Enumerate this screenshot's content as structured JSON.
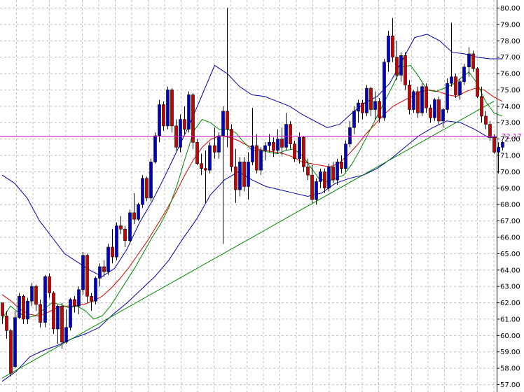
{
  "chart_data": {
    "type": "candlestick",
    "title": "",
    "xlabel": "",
    "ylabel": "",
    "ylim": [
      56.5,
      80.4
    ],
    "y_ticks": [
      "57.00",
      "58.00",
      "59.00",
      "60.00",
      "61.00",
      "62.00",
      "63.00",
      "64.00",
      "65.00",
      "66.00",
      "67.00",
      "68.00",
      "69.00",
      "70.00",
      "71.00",
      "72.00",
      "73.00",
      "74.00",
      "75.00",
      "76.00",
      "77.00",
      "78.00",
      "79.00",
      "80.00"
    ],
    "grid": true,
    "current_price": "72.17",
    "colors": {
      "up_candle": "#0000cc",
      "down_candle": "#cc0000",
      "bollinger": "#0000aa",
      "ma_fast": "#008800",
      "ma_slow": "#dd0000",
      "trendline": "#008800",
      "price_line": "#cc00cc",
      "grid": "#c0c0c0"
    },
    "ohlc": [
      [
        62.0,
        62.0,
        60.7,
        61.2
      ],
      [
        61.2,
        61.5,
        59.8,
        60.3
      ],
      [
        60.3,
        60.4,
        57.5,
        57.7
      ],
      [
        58.1,
        61.5,
        58.0,
        61.1
      ],
      [
        61.1,
        62.6,
        61.0,
        62.4
      ],
      [
        62.4,
        62.5,
        60.7,
        61.0
      ],
      [
        61.0,
        62.3,
        60.7,
        62.1
      ],
      [
        62.1,
        63.2,
        61.8,
        63.0
      ],
      [
        63.0,
        63.1,
        61.5,
        61.9
      ],
      [
        61.9,
        62.2,
        60.5,
        60.8
      ],
      [
        60.8,
        63.7,
        60.5,
        63.6
      ],
      [
        63.6,
        63.8,
        62.3,
        62.6
      ],
      [
        62.6,
        62.7,
        60.1,
        60.4
      ],
      [
        60.4,
        61.9,
        59.5,
        61.8
      ],
      [
        61.8,
        62.0,
        59.2,
        59.6
      ],
      [
        59.6,
        61.6,
        59.5,
        60.5
      ],
      [
        60.5,
        62.3,
        60.3,
        62.2
      ],
      [
        62.2,
        62.4,
        61.4,
        61.8
      ],
      [
        61.8,
        63.0,
        61.3,
        62.8
      ],
      [
        62.8,
        65.1,
        62.5,
        64.9
      ],
      [
        64.9,
        65.0,
        62.0,
        62.4
      ],
      [
        62.4,
        62.6,
        61.5,
        62.1
      ],
      [
        62.1,
        63.6,
        61.9,
        63.5
      ],
      [
        63.5,
        64.4,
        63.0,
        64.2
      ],
      [
        64.2,
        64.6,
        63.6,
        63.9
      ],
      [
        63.9,
        65.6,
        63.7,
        65.4
      ],
      [
        65.4,
        66.5,
        64.4,
        64.8
      ],
      [
        64.8,
        66.9,
        64.6,
        66.7
      ],
      [
        66.7,
        67.3,
        66.2,
        66.5
      ],
      [
        66.5,
        66.7,
        65.4,
        65.8
      ],
      [
        65.8,
        67.7,
        65.6,
        67.5
      ],
      [
        67.5,
        68.7,
        66.8,
        67.1
      ],
      [
        67.1,
        68.1,
        67.0,
        68.0
      ],
      [
        68.0,
        69.8,
        67.8,
        69.6
      ],
      [
        69.6,
        69.7,
        68.2,
        68.4
      ],
      [
        68.4,
        70.8,
        68.2,
        70.6
      ],
      [
        70.6,
        72.4,
        70.5,
        72.2
      ],
      [
        72.2,
        74.4,
        71.8,
        74.1
      ],
      [
        74.1,
        74.3,
        72.5,
        72.8
      ],
      [
        72.8,
        75.2,
        72.6,
        75.0
      ],
      [
        75.0,
        75.1,
        72.4,
        72.8
      ],
      [
        72.8,
        73.2,
        71.3,
        71.5
      ],
      [
        71.5,
        73.5,
        71.2,
        73.2
      ],
      [
        73.2,
        74.0,
        72.3,
        72.6
      ],
      [
        72.6,
        74.9,
        72.4,
        74.7
      ],
      [
        74.7,
        74.8,
        71.4,
        71.8
      ],
      [
        71.8,
        72.0,
        70.4,
        70.5
      ],
      [
        70.5,
        71.1,
        69.8,
        70.2
      ],
      [
        70.2,
        71.3,
        68.1,
        70.1
      ],
      [
        70.1,
        71.8,
        69.9,
        71.6
      ],
      [
        71.6,
        72.7,
        70.8,
        71.2
      ],
      [
        71.2,
        72.4,
        70.8,
        72.2
      ],
      [
        72.2,
        74.0,
        65.6,
        73.7
      ],
      [
        73.7,
        80.0,
        71.5,
        72.6
      ],
      [
        72.6,
        72.9,
        70.0,
        70.3
      ],
      [
        70.3,
        71.4,
        68.1,
        68.9
      ],
      [
        68.9,
        70.9,
        68.5,
        70.6
      ],
      [
        70.6,
        70.9,
        68.8,
        69.1
      ],
      [
        69.1,
        71.2,
        68.3,
        70.6
      ],
      [
        70.6,
        73.9,
        70.4,
        71.6
      ],
      [
        71.6,
        72.3,
        69.9,
        70.1
      ],
      [
        70.1,
        71.5,
        69.8,
        71.3
      ],
      [
        71.3,
        71.8,
        70.7,
        71.6
      ],
      [
        71.6,
        72.3,
        71.2,
        71.8
      ],
      [
        71.8,
        72.1,
        70.9,
        71.3
      ],
      [
        71.3,
        72.6,
        71.1,
        72.0
      ],
      [
        72.0,
        72.7,
        71.0,
        71.5
      ],
      [
        71.5,
        73.6,
        71.3,
        72.9
      ],
      [
        72.9,
        73.1,
        71.4,
        71.7
      ],
      [
        71.7,
        71.9,
        70.6,
        70.8
      ],
      [
        70.8,
        72.4,
        70.5,
        72.1
      ],
      [
        72.1,
        72.2,
        70.0,
        70.3
      ],
      [
        70.3,
        70.8,
        69.5,
        69.8
      ],
      [
        69.8,
        70.4,
        68.1,
        68.3
      ],
      [
        68.3,
        69.6,
        68.0,
        69.4
      ],
      [
        69.4,
        70.2,
        69.0,
        70.0
      ],
      [
        70.0,
        70.2,
        68.7,
        69.0
      ],
      [
        69.0,
        70.5,
        68.8,
        70.3
      ],
      [
        70.3,
        70.6,
        69.3,
        69.5
      ],
      [
        69.5,
        70.8,
        69.2,
        70.6
      ],
      [
        70.6,
        71.0,
        69.9,
        70.2
      ],
      [
        70.2,
        71.9,
        70.0,
        71.7
      ],
      [
        71.7,
        73.1,
        71.5,
        72.7
      ],
      [
        72.7,
        74.0,
        72.3,
        73.7
      ],
      [
        73.7,
        74.4,
        73.0,
        74.2
      ],
      [
        74.2,
        74.4,
        73.2,
        73.6
      ],
      [
        73.6,
        75.3,
        73.4,
        75.1
      ],
      [
        75.1,
        75.2,
        73.4,
        73.8
      ],
      [
        73.8,
        74.9,
        73.2,
        74.3
      ],
      [
        74.3,
        74.5,
        73.0,
        73.3
      ],
      [
        73.3,
        76.9,
        73.1,
        76.7
      ],
      [
        76.7,
        78.6,
        76.1,
        78.3
      ],
      [
        78.3,
        79.4,
        76.7,
        77.0
      ],
      [
        77.0,
        78.0,
        75.6,
        75.9
      ],
      [
        75.9,
        77.3,
        75.5,
        77.1
      ],
      [
        77.1,
        77.3,
        75.0,
        75.3
      ],
      [
        75.3,
        75.6,
        73.5,
        73.8
      ],
      [
        73.8,
        75.0,
        73.6,
        74.9
      ],
      [
        74.9,
        75.2,
        73.3,
        73.6
      ],
      [
        73.6,
        75.4,
        73.4,
        75.2
      ],
      [
        75.2,
        75.4,
        73.6,
        73.9
      ],
      [
        73.9,
        74.1,
        73.0,
        73.3
      ],
      [
        73.3,
        74.5,
        73.1,
        74.4
      ],
      [
        74.4,
        74.6,
        72.9,
        73.1
      ],
      [
        73.1,
        73.9,
        72.7,
        73.8
      ],
      [
        73.8,
        75.7,
        73.6,
        75.4
      ],
      [
        75.4,
        79.1,
        75.2,
        75.8
      ],
      [
        75.8,
        76.0,
        74.5,
        74.7
      ],
      [
        74.7,
        75.7,
        74.4,
        75.5
      ],
      [
        75.5,
        76.6,
        75.3,
        76.4
      ],
      [
        76.4,
        77.6,
        75.8,
        77.2
      ],
      [
        77.2,
        77.4,
        76.1,
        76.3
      ],
      [
        76.3,
        76.4,
        74.5,
        74.6
      ],
      [
        74.6,
        75.2,
        73.0,
        73.4
      ],
      [
        73.4,
        73.7,
        72.6,
        72.9
      ],
      [
        72.9,
        73.1,
        71.9,
        72.1
      ],
      [
        72.1,
        72.3,
        71.1,
        71.2
      ],
      [
        71.2,
        71.8,
        69.9,
        71.5
      ],
      [
        71.5,
        72.0,
        71.3,
        71.8
      ]
    ],
    "moving_average_fast": [
      61.0,
      61.8,
      61.4,
      61.1,
      61.2,
      61.6,
      62.0,
      61.9,
      61.7,
      61.8,
      61.5,
      61.0,
      61.2,
      61.8,
      62.6,
      63.4,
      64.2,
      65.1,
      66.0,
      66.8,
      67.8,
      69.2,
      70.9,
      72.5,
      73.2,
      73.0,
      72.6,
      72.6,
      72.4,
      71.8,
      71.3,
      71.3,
      71.2,
      71.1,
      71.3,
      71.4,
      71.0,
      70.3,
      69.6,
      69.4,
      69.6,
      69.8,
      70.5,
      71.4,
      72.4,
      73.4,
      74.4,
      75.4,
      76.4,
      76.5,
      75.8,
      75.0,
      74.9,
      75.1,
      75.3,
      75.7,
      76.1,
      75.4,
      74.3,
      73.6,
      73.4
    ],
    "moving_average_slow": [
      62.5,
      62.1,
      61.6,
      61.3,
      61.2,
      61.4,
      61.7,
      61.8,
      61.8,
      61.9,
      62.1,
      62.4,
      62.9,
      63.5,
      64.2,
      65.0,
      65.8,
      66.7,
      67.6,
      68.6,
      69.7,
      70.7,
      71.5,
      72.0,
      72.2,
      72.1,
      71.9,
      71.6,
      71.4,
      71.3,
      71.2,
      71.1,
      70.9,
      70.6,
      70.5,
      70.4,
      70.3,
      70.5,
      71.0,
      71.6,
      72.3,
      72.9,
      73.5,
      74.0,
      74.3,
      74.6,
      74.9,
      75.0,
      74.9,
      74.7,
      74.6,
      74.9,
      75.1,
      75.0,
      74.6,
      74.3
    ],
    "bollinger_upper": [
      69.8,
      69.3,
      68.4,
      67.0,
      66.0,
      65.0,
      64.5,
      64.0,
      63.6,
      64.1,
      65.3,
      66.9,
      68.2,
      69.7,
      71.3,
      72.9,
      74.7,
      76.5,
      76.0,
      75.2,
      74.7,
      74.6,
      74.3,
      74.0,
      73.5,
      73.1,
      72.7,
      72.9,
      73.6,
      74.2,
      74.6,
      75.4,
      76.8,
      78.2,
      78.4,
      78.0,
      77.3,
      77.2,
      77.0,
      76.9,
      76.9
    ],
    "bollinger_lower": [
      57.2,
      57.8,
      58.7,
      59.1,
      59.4,
      59.8,
      60.1,
      60.5,
      61.3,
      62.0,
      62.8,
      63.6,
      64.6,
      65.9,
      67.1,
      68.6,
      69.5,
      70.0,
      69.5,
      69.1,
      68.9,
      68.7,
      68.5,
      68.7,
      69.3,
      69.6,
      69.8,
      70.2,
      70.8,
      71.5,
      72.2,
      72.7,
      73.1,
      73.0,
      72.6,
      72.1,
      72.1
    ],
    "trendline": [
      [
        0,
        57.4
      ],
      [
        116,
        74.3
      ]
    ]
  }
}
